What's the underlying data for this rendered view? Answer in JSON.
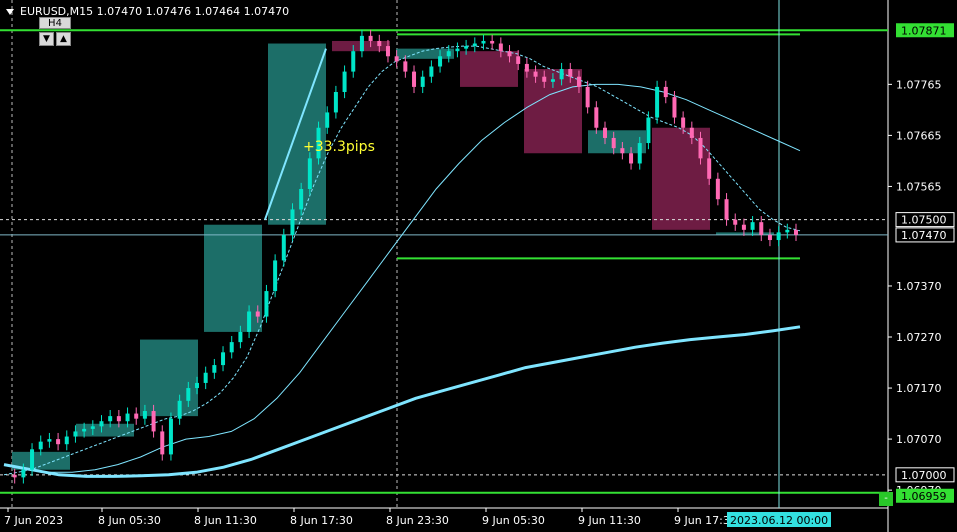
{
  "window": {
    "symbol_header": "EURUSD,M15  1.07470 1.07476 1.07464 1.07470",
    "overlay_timeframe": "H4",
    "arrow_down": "▼",
    "arrow_up": "▲",
    "collapse_button": "-"
  },
  "colors": {
    "background": "#000000",
    "bull_candle": "#00e5c8",
    "bear_candle": "#ff69b4",
    "htf_bull_box": "#1f7a73",
    "htf_bear_box": "#7a1f4a",
    "level_line": "#33e033",
    "ma": "#7fe5ff",
    "current_price_line": "#7fb8c8",
    "crosshair": "#7fe5e5"
  },
  "chart_data": {
    "type": "line",
    "title": "EURUSD,M15",
    "ohlc_current": {
      "open": 1.0747,
      "high": 1.07476,
      "low": 1.07464,
      "close": 1.0747
    },
    "y_ticks": [
      "1.07765",
      "1.07665",
      "1.07565",
      "1.07370",
      "1.07270",
      "1.07170",
      "1.07070",
      "1.06970"
    ],
    "ylim": [
      1.06935,
      1.07895
    ],
    "x_ticks": [
      "7 Jun 2023",
      "8 Jun 05:30",
      "8 Jun 11:30",
      "8 Jun 17:30",
      "8 Jun 23:30",
      "9 Jun 05:30",
      "9 Jun 11:30",
      "9 Jun 17:30"
    ],
    "price_labels": [
      {
        "text": "1.07871",
        "value": 1.07871,
        "style": "green"
      },
      {
        "text": "1.07500",
        "value": 1.075,
        "style": "white"
      },
      {
        "text": "1.07470",
        "value": 1.0747,
        "style": "white"
      },
      {
        "text": "1.07000",
        "value": 1.07,
        "style": "white"
      },
      {
        "text": "1.06959",
        "value": 1.06959,
        "style": "green"
      }
    ],
    "crosshair_time_label": "2023.06.12 00:00",
    "annotation": {
      "text": "+33.3pips"
    },
    "horizontal_levels": [
      1.07871,
      1.07863,
      1.07424,
      1.06965
    ],
    "htf_boxes": [
      {
        "dir": "bull",
        "open": 1.0701,
        "close": 1.07045
      },
      {
        "dir": "bull",
        "open": 1.07075,
        "close": 1.071
      },
      {
        "dir": "bull",
        "open": 1.07115,
        "close": 1.07265
      },
      {
        "dir": "bull",
        "open": 1.0728,
        "close": 1.0749
      },
      {
        "dir": "bull",
        "open": 1.0749,
        "close": 1.07845
      },
      {
        "dir": "bear",
        "open": 1.0785,
        "close": 1.0783
      },
      {
        "dir": "bull",
        "open": 1.07815,
        "close": 1.07835
      },
      {
        "dir": "bear",
        "open": 1.0783,
        "close": 1.0776
      },
      {
        "dir": "bear",
        "open": 1.07795,
        "close": 1.0763
      },
      {
        "dir": "bull",
        "open": 1.0763,
        "close": 1.07675
      },
      {
        "dir": "bear",
        "open": 1.0768,
        "close": 1.0748
      },
      {
        "dir": "bull",
        "open": 1.0747,
        "close": 1.07475
      }
    ],
    "price_series": [
      1.07,
      1.06995,
      1.0701,
      1.0705,
      1.07065,
      1.0707,
      1.0706,
      1.07075,
      1.07085,
      1.0709,
      1.07095,
      1.07105,
      1.07115,
      1.07105,
      1.0712,
      1.0711,
      1.07125,
      1.07085,
      1.0704,
      1.0711,
      1.07145,
      1.0717,
      1.0718,
      1.072,
      1.07215,
      1.0724,
      1.0726,
      1.0728,
      1.0732,
      1.0731,
      1.0736,
      1.0742,
      1.0747,
      1.0752,
      1.0756,
      1.0762,
      1.0768,
      1.0771,
      1.0775,
      1.0779,
      1.0783,
      1.0786,
      1.0785,
      1.0784,
      1.0782,
      1.0781,
      1.0779,
      1.0776,
      1.0778,
      1.078,
      1.0782,
      1.0783,
      1.07835,
      1.0784,
      1.07845,
      1.0785,
      1.07845,
      1.0783,
      1.0782,
      1.07805,
      1.0779,
      1.0778,
      1.0777,
      1.07775,
      1.07795,
      1.0778,
      1.0776,
      1.0772,
      1.0768,
      1.0766,
      1.0764,
      1.0763,
      1.0761,
      1.0765,
      1.077,
      1.0776,
      1.0774,
      1.077,
      1.0768,
      1.0766,
      1.0762,
      1.0758,
      1.0754,
      1.075,
      1.0749,
      1.0748,
      1.07495,
      1.0747,
      1.0746,
      1.07475,
      1.0748,
      1.0747
    ],
    "ma_fast": [
      1.07,
      1.07005,
      1.0701,
      1.0702,
      1.0703,
      1.0704,
      1.0705,
      1.0706,
      1.0707,
      1.0708,
      1.0709,
      1.071,
      1.0711,
      1.07115,
      1.07125,
      1.0714,
      1.0716,
      1.0719,
      1.0723,
      1.0729,
      1.0736,
      1.0743,
      1.075,
      1.0757,
      1.0763,
      1.0768,
      1.0772,
      1.0776,
      1.0779,
      1.0781,
      1.0782,
      1.0783,
      1.07835,
      1.07838,
      1.0784,
      1.0784,
      1.07835,
      1.0783,
      1.07825,
      1.07815,
      1.078,
      1.0779,
      1.0778,
      1.0777,
      1.0776,
      1.07745,
      1.0773,
      1.07715,
      1.077,
      1.0769,
      1.0768,
      1.07665,
      1.0764,
      1.0761,
      1.0758,
      1.0755,
      1.0752,
      1.075,
      1.07485,
      1.07478
    ],
    "ma_mid": [
      1.0702,
      1.0701,
      1.07005,
      1.07005,
      1.0701,
      1.0702,
      1.07035,
      1.07055,
      1.0707,
      1.07075,
      1.07085,
      1.0711,
      1.0715,
      1.072,
      1.0726,
      1.0732,
      1.0738,
      1.0744,
      1.075,
      1.0756,
      1.0761,
      1.07655,
      1.0769,
      1.0772,
      1.07745,
      1.0776,
      1.07765,
      1.07765,
      1.0776,
      1.0775,
      1.07735,
      1.07715,
      1.07695,
      1.07675,
      1.07655,
      1.07635
    ],
    "ma_slow": [
      1.0702,
      1.0701,
      1.07,
      1.06997,
      1.06997,
      1.06998,
      1.07,
      1.07005,
      1.07015,
      1.0703,
      1.0705,
      1.0707,
      1.0709,
      1.0711,
      1.0713,
      1.0715,
      1.07165,
      1.0718,
      1.07195,
      1.0721,
      1.0722,
      1.0723,
      1.0724,
      1.0725,
      1.07258,
      1.07265,
      1.0727,
      1.07275,
      1.07282,
      1.0729
    ]
  }
}
